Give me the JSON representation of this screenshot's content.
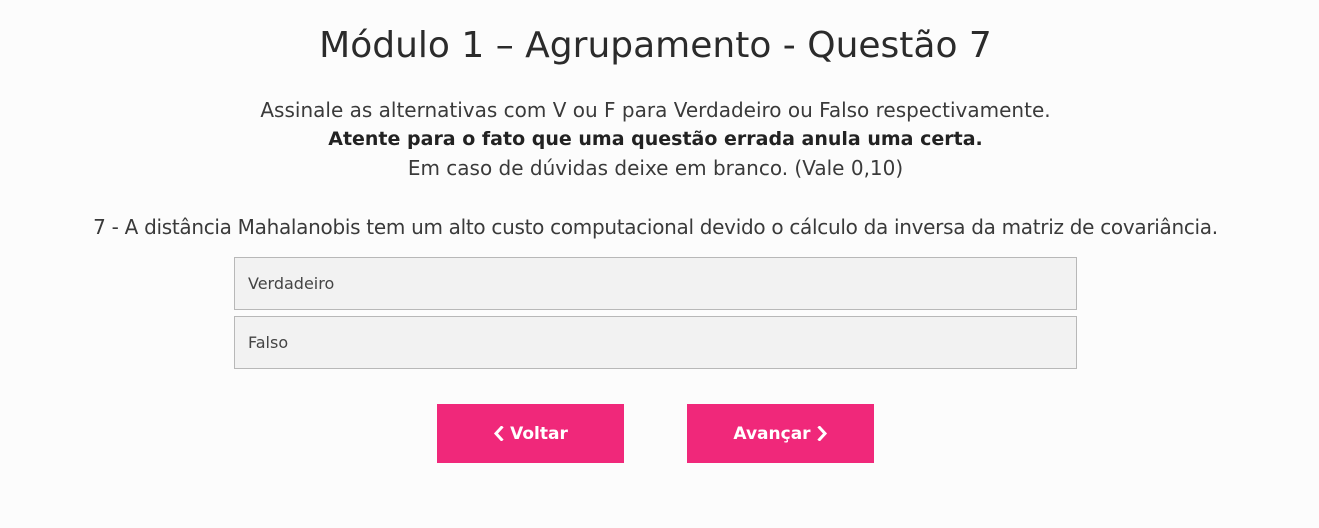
{
  "header": {
    "title": "Módulo 1 – Agrupamento - Questão 7"
  },
  "instructions": {
    "line1": "Assinale as alternativas com V ou F para Verdadeiro ou Falso respectivamente.",
    "line2": "Atente para o fato que uma questão errada anula uma certa.",
    "line3": "Em caso de dúvidas deixe em branco. (Vale 0,10)"
  },
  "question": {
    "text": "7 - A distância Mahalanobis tem um alto custo computacional devido o cálculo da inversa da matriz de covariância.",
    "options": [
      {
        "label": "Verdadeiro"
      },
      {
        "label": "Falso"
      }
    ]
  },
  "navigation": {
    "back_label": "Voltar",
    "next_label": "Avançar",
    "back_icon": "chevron-left-icon",
    "next_icon": "chevron-right-icon"
  },
  "colors": {
    "accent": "#f0287a",
    "option_bg": "#f2f2f2",
    "option_border": "#b8b8b8"
  }
}
